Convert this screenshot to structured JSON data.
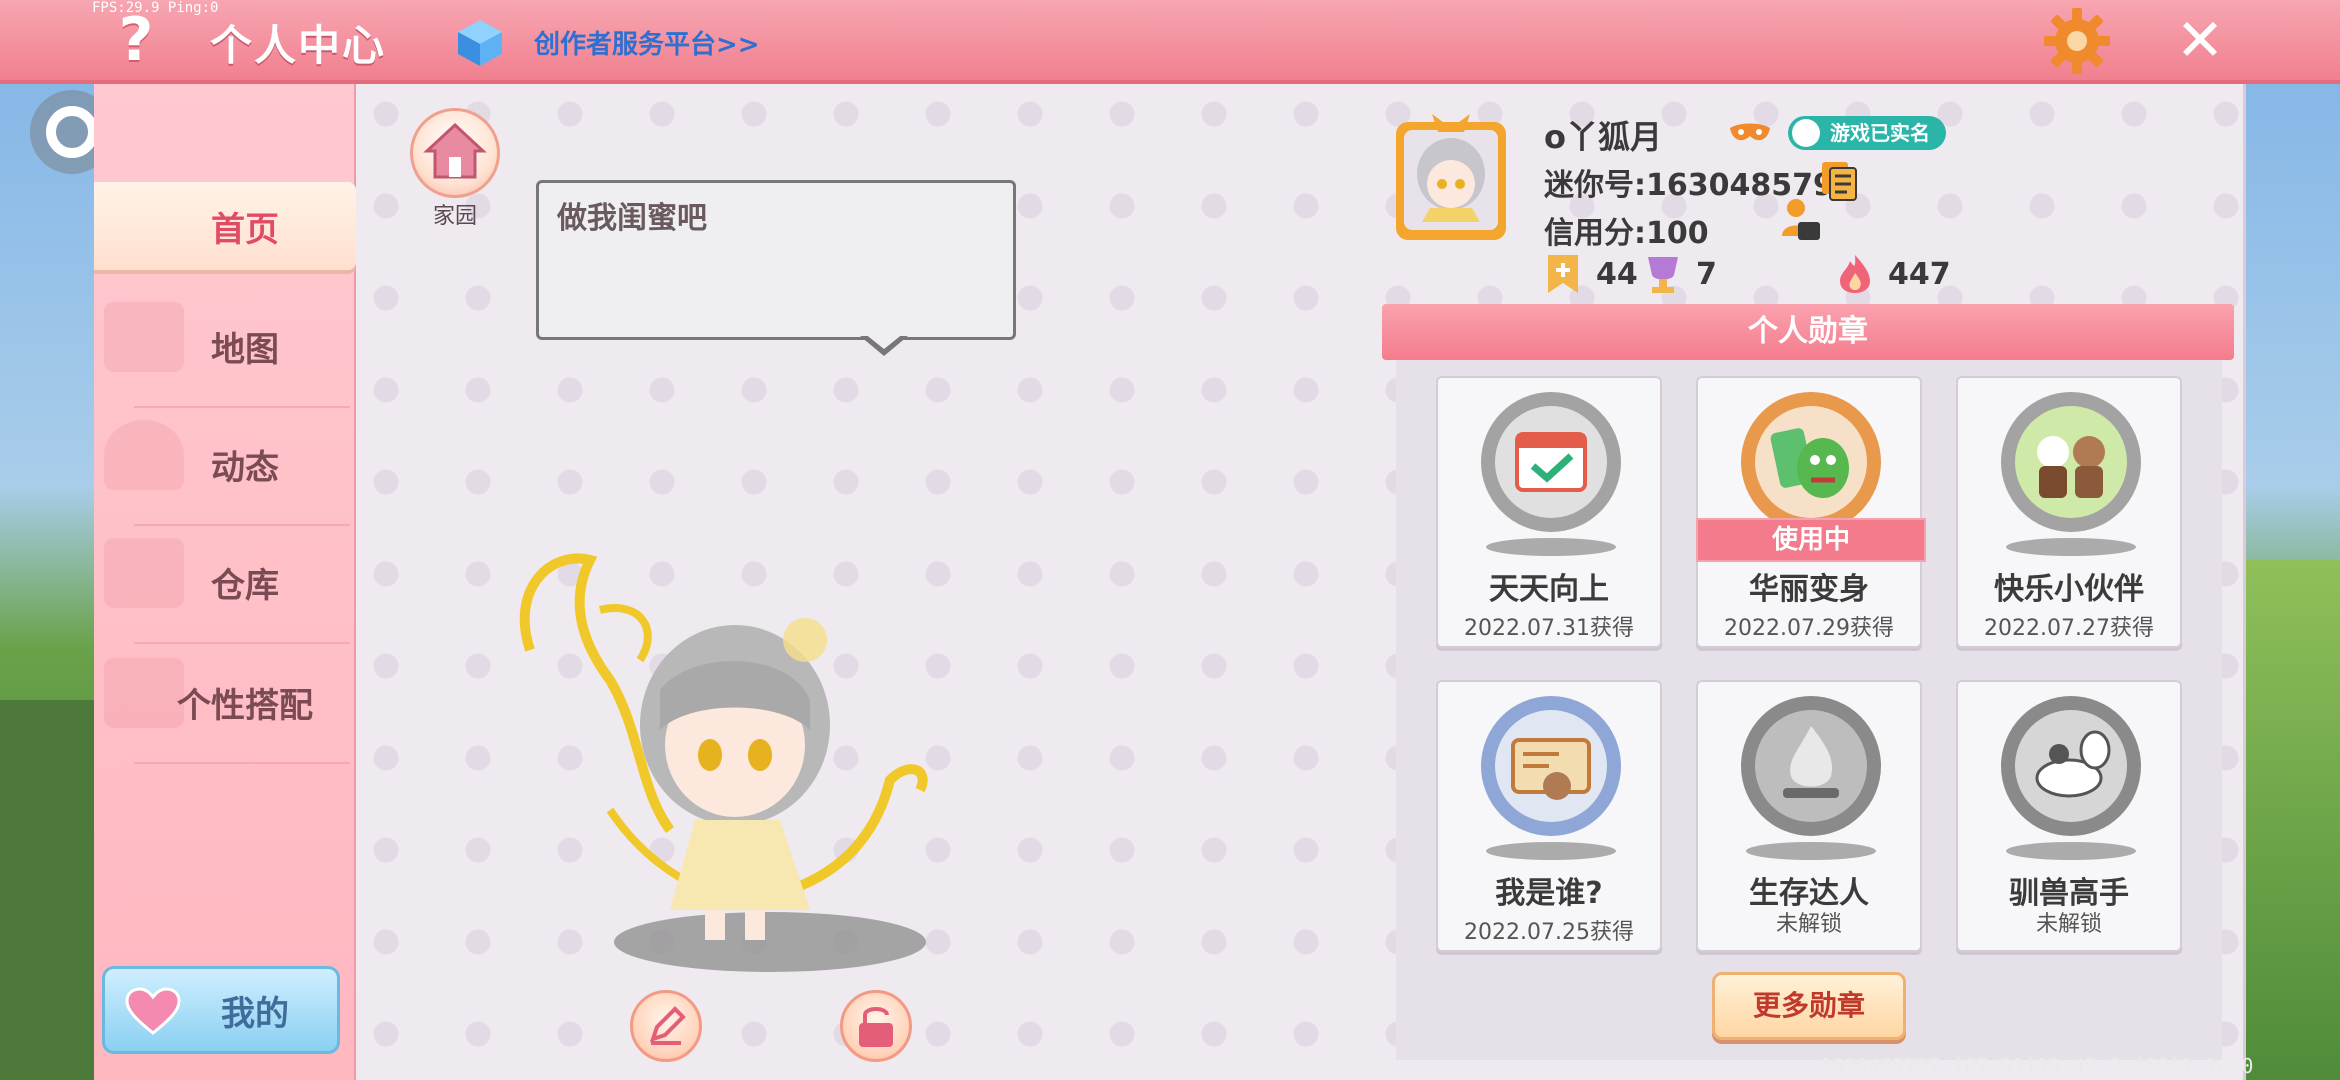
{
  "status": {
    "fps": "FPS:29.9 Ping:0"
  },
  "header": {
    "help_label": "?",
    "title": "个人中心",
    "creator_link": "创作者服务平台>>",
    "close_label": "✕"
  },
  "sidebar": {
    "items": [
      {
        "label": "首页",
        "active": true
      },
      {
        "label": "地图"
      },
      {
        "label": "动态"
      },
      {
        "label": "仓库"
      },
      {
        "label": "个性搭配"
      }
    ],
    "mine_label": "我的"
  },
  "home": {
    "label": "家园"
  },
  "speech": {
    "text": "做我闺蜜吧"
  },
  "profile": {
    "nickname": "o丫狐月",
    "realname_badge": "游戏已实名",
    "mini_id": "迷你号:1630485797",
    "credit": "信用分:100",
    "stats": {
      "bookmark": "44",
      "cup": "7",
      "fire": "447"
    }
  },
  "medals": {
    "header": "个人勋章",
    "items": [
      {
        "name": "天天向上",
        "date": "2022.07.31获得"
      },
      {
        "name": "华丽变身",
        "date": "2022.07.29获得",
        "status": "使用中"
      },
      {
        "name": "快乐小伙伴",
        "date": "2022.07.27获得"
      },
      {
        "name": "我是谁?",
        "date": "2022.07.25获得"
      },
      {
        "name": "生存达人",
        "date": "未解锁"
      },
      {
        "name": "驯兽高手",
        "date": "未解锁"
      }
    ],
    "more_label": "更多勋章"
  },
  "footer": {
    "info": "1630485797  [07/31]13:42 0  [58]1.16.0"
  },
  "colors": {
    "accent": "#f1808f",
    "teal": "#2bb5a8",
    "sidebar": "#ffc9cf"
  }
}
